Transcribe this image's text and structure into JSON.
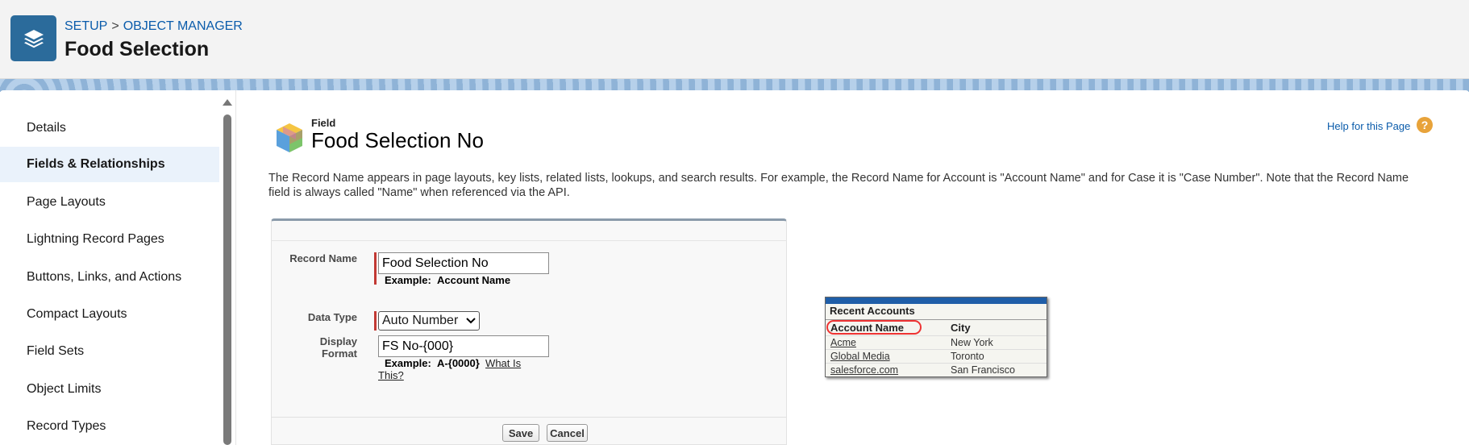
{
  "header": {
    "breadcrumb": [
      "SETUP",
      "OBJECT MANAGER"
    ],
    "breadcrumb_separator": ">",
    "title": "Food Selection",
    "icon": "layers-icon"
  },
  "sidebar": {
    "items": [
      {
        "label": "Details",
        "active": false
      },
      {
        "label": "Fields & Relationships",
        "active": true
      },
      {
        "label": "Page Layouts",
        "active": false
      },
      {
        "label": "Lightning Record Pages",
        "active": false
      },
      {
        "label": "Buttons, Links, and Actions",
        "active": false
      },
      {
        "label": "Compact Layouts",
        "active": false
      },
      {
        "label": "Field Sets",
        "active": false
      },
      {
        "label": "Object Limits",
        "active": false
      },
      {
        "label": "Record Types",
        "active": false
      }
    ]
  },
  "main": {
    "field_label": "Field",
    "field_title": "Food Selection No",
    "help_link": "Help for this Page",
    "description": "The Record Name appears in page layouts, key lists, related lists, lookups, and search results. For example, the Record Name for Account is \"Account Name\" and for Case it is \"Case Number\". Note that the Record Name field is always called \"Name\" when referenced via the API."
  },
  "form": {
    "record_name_label": "Record Name",
    "record_name_value": "Food Selection No",
    "record_name_example_prefix": "Example:",
    "record_name_example": "Account Name",
    "data_type_label": "Data Type",
    "data_type_value": "Auto Number",
    "display_format_label_1": "Display",
    "display_format_label_2": "Format",
    "display_format_value": "FS No-{000}",
    "display_format_example_prefix": "Example:",
    "display_format_example": "A-{0000}",
    "what_is_link_1": "What Is",
    "what_is_link_2": "This?",
    "save_label": "Save",
    "cancel_label": "Cancel"
  },
  "recent_accounts": {
    "title": "Recent Accounts",
    "columns": [
      "Account Name",
      "City"
    ],
    "rows": [
      {
        "name": "Acme",
        "city": "New York"
      },
      {
        "name": "Global Media",
        "city": "Toronto"
      },
      {
        "name": "salesforce.com",
        "city": "San Francisco"
      }
    ]
  },
  "colors": {
    "accent": "#0b5cab",
    "header_icon_bg": "#2b6b9b",
    "required_bar": "#c23934",
    "help_icon": "#e8a33a"
  }
}
